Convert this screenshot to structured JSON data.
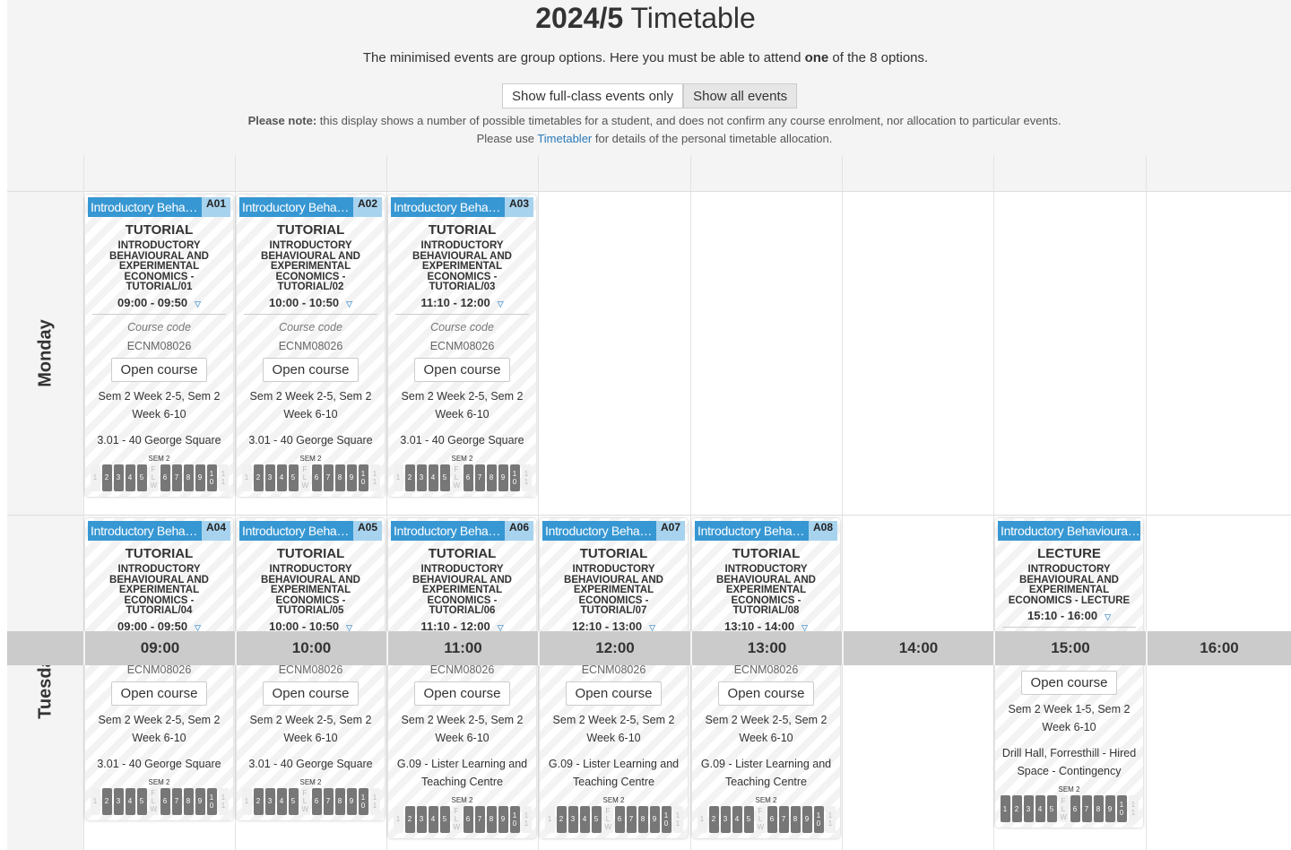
{
  "title": {
    "bold": "2024/5",
    "rest": "Timetable"
  },
  "intro": {
    "before": "The minimised events are group options. Here you must be able to attend ",
    "bold": "one",
    "after": " of the 8 options."
  },
  "toggle": {
    "full_class": "Show full-class events only",
    "all": "Show all events",
    "active": "all"
  },
  "note": {
    "bold": "Please note:",
    "text": " this display shows a number of possible timetables for a student, and does not confirm any course enrolment, nor allocation to particular events. Please use ",
    "link": "Timetabler",
    "after": " for details of the personal timetable allocation."
  },
  "days": [
    "Monday",
    "Tuesday"
  ],
  "times": [
    "09:00",
    "10:00",
    "11:00",
    "12:00",
    "13:00",
    "14:00",
    "15:00",
    "16:00"
  ],
  "colors": {
    "header": "#3797d3",
    "group": "#a8d3ee",
    "week_active": "#777777"
  },
  "labels": {
    "course_code": "Course code",
    "open": "Open course",
    "sem": "SEM 2"
  },
  "events": [
    {
      "day": 0,
      "col": 0,
      "title": "Introductory Behavioural and Experimental Economics",
      "group": "A01",
      "type": "TUTORIAL",
      "name": "Introductory Behavioural and Experimental Economics - Tutorial/01",
      "time": "09:00 - 09:50",
      "code": "ECNM08026",
      "weeks": "Sem 2 Week 2-5, Sem 2 Week 6-10",
      "location": "3.01 - 40 George Square",
      "week_bar": [
        "1",
        "2",
        "3",
        "4",
        "5",
        "FLW",
        "6",
        "7",
        "8",
        "9",
        "10",
        "11"
      ],
      "active": [
        0,
        1,
        1,
        1,
        1,
        0,
        1,
        1,
        1,
        1,
        1,
        0
      ]
    },
    {
      "day": 0,
      "col": 1,
      "title": "Introductory Behavioural and Experimental Economics",
      "group": "A02",
      "type": "TUTORIAL",
      "name": "Introductory Behavioural and Experimental Economics - Tutorial/02",
      "time": "10:00 - 10:50",
      "code": "ECNM08026",
      "weeks": "Sem 2 Week 2-5, Sem 2 Week 6-10",
      "location": "3.01 - 40 George Square",
      "week_bar": [
        "1",
        "2",
        "3",
        "4",
        "5",
        "FLW",
        "6",
        "7",
        "8",
        "9",
        "10",
        "11"
      ],
      "active": [
        0,
        1,
        1,
        1,
        1,
        0,
        1,
        1,
        1,
        1,
        1,
        0
      ]
    },
    {
      "day": 0,
      "col": 2,
      "title": "Introductory Behavioural and Experimental Economics",
      "group": "A03",
      "type": "TUTORIAL",
      "name": "Introductory Behavioural and Experimental Economics - Tutorial/03",
      "time": "11:10 - 12:00",
      "code": "ECNM08026",
      "weeks": "Sem 2 Week 2-5, Sem 2 Week 6-10",
      "location": "3.01 - 40 George Square",
      "week_bar": [
        "1",
        "2",
        "3",
        "4",
        "5",
        "FLW",
        "6",
        "7",
        "8",
        "9",
        "10",
        "11"
      ],
      "active": [
        0,
        1,
        1,
        1,
        1,
        0,
        1,
        1,
        1,
        1,
        1,
        0
      ]
    },
    {
      "day": 1,
      "col": 0,
      "title": "Introductory Behavioural and Experimental Economics",
      "group": "A04",
      "type": "TUTORIAL",
      "name": "Introductory Behavioural and Experimental Economics - Tutorial/04",
      "time": "09:00 - 09:50",
      "code": "ECNM08026",
      "weeks": "Sem 2 Week 2-5, Sem 2 Week 6-10",
      "location": "3.01 - 40 George Square",
      "week_bar": [
        "1",
        "2",
        "3",
        "4",
        "5",
        "FLW",
        "6",
        "7",
        "8",
        "9",
        "10",
        "11"
      ],
      "active": [
        0,
        1,
        1,
        1,
        1,
        0,
        1,
        1,
        1,
        1,
        1,
        0
      ]
    },
    {
      "day": 1,
      "col": 1,
      "title": "Introductory Behavioural and Experimental Economics",
      "group": "A05",
      "type": "TUTORIAL",
      "name": "Introductory Behavioural and Experimental Economics - Tutorial/05",
      "time": "10:00 - 10:50",
      "code": "ECNM08026",
      "weeks": "Sem 2 Week 2-5, Sem 2 Week 6-10",
      "location": "3.01 - 40 George Square",
      "week_bar": [
        "1",
        "2",
        "3",
        "4",
        "5",
        "FLW",
        "6",
        "7",
        "8",
        "9",
        "10",
        "11"
      ],
      "active": [
        0,
        1,
        1,
        1,
        1,
        0,
        1,
        1,
        1,
        1,
        1,
        0
      ]
    },
    {
      "day": 1,
      "col": 2,
      "title": "Introductory Behavioural and Experimental Economics",
      "group": "A06",
      "type": "TUTORIAL",
      "name": "Introductory Behavioural and Experimental Economics - Tutorial/06",
      "time": "11:10 - 12:00",
      "code": "ECNM08026",
      "weeks": "Sem 2 Week 2-5, Sem 2 Week 6-10",
      "location": "G.09 - Lister Learning and Teaching Centre",
      "week_bar": [
        "1",
        "2",
        "3",
        "4",
        "5",
        "FLW",
        "6",
        "7",
        "8",
        "9",
        "10",
        "11"
      ],
      "active": [
        0,
        1,
        1,
        1,
        1,
        0,
        1,
        1,
        1,
        1,
        1,
        0
      ]
    },
    {
      "day": 1,
      "col": 3,
      "title": "Introductory Behavioural and Experimental Economics",
      "group": "A07",
      "type": "TUTORIAL",
      "name": "Introductory Behavioural and Experimental Economics - Tutorial/07",
      "time": "12:10 - 13:00",
      "code": "ECNM08026",
      "weeks": "Sem 2 Week 2-5, Sem 2 Week 6-10",
      "location": "G.09 - Lister Learning and Teaching Centre",
      "week_bar": [
        "1",
        "2",
        "3",
        "4",
        "5",
        "FLW",
        "6",
        "7",
        "8",
        "9",
        "10",
        "11"
      ],
      "active": [
        0,
        1,
        1,
        1,
        1,
        0,
        1,
        1,
        1,
        1,
        1,
        0
      ]
    },
    {
      "day": 1,
      "col": 4,
      "title": "Introductory Behavioural and Experimental Economics",
      "group": "A08",
      "type": "TUTORIAL",
      "name": "Introductory Behavioural and Experimental Economics - Tutorial/08",
      "time": "13:10 - 14:00",
      "code": "ECNM08026",
      "weeks": "Sem 2 Week 2-5, Sem 2 Week 6-10",
      "location": "G.09 - Lister Learning and Teaching Centre",
      "week_bar": [
        "1",
        "2",
        "3",
        "4",
        "5",
        "FLW",
        "6",
        "7",
        "8",
        "9",
        "10",
        "11"
      ],
      "active": [
        0,
        1,
        1,
        1,
        1,
        0,
        1,
        1,
        1,
        1,
        1,
        0
      ]
    },
    {
      "day": 1,
      "col": 6,
      "title": "Introductory Behavioural and Experimental Economics",
      "group": "",
      "type": "LECTURE",
      "name": "Introductory Behavioural and Experimental Economics - Lecture",
      "time": "15:10 - 16:00",
      "code": "ECNM08026",
      "weeks": "Sem 2 Week 1-5, Sem 2 Week 6-10",
      "location": "Drill Hall, Forresthill - Hired Space - Contingency",
      "week_bar": [
        "1",
        "2",
        "3",
        "4",
        "5",
        "FLW",
        "6",
        "7",
        "8",
        "9",
        "10",
        "11"
      ],
      "active": [
        1,
        1,
        1,
        1,
        1,
        0,
        1,
        1,
        1,
        1,
        1,
        0
      ]
    }
  ]
}
